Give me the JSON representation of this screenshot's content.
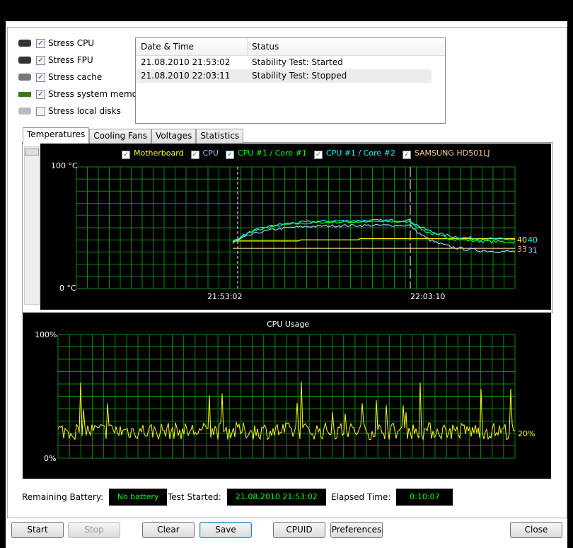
{
  "options": [
    {
      "label": "Stress CPU",
      "checked": true,
      "icon": "cpu-icon"
    },
    {
      "label": "Stress FPU",
      "checked": true,
      "icon": "fpu-icon"
    },
    {
      "label": "Stress cache",
      "checked": true,
      "icon": "cache-chip-icon"
    },
    {
      "label": "Stress system memory",
      "checked": true,
      "icon": "memory-icon"
    },
    {
      "label": "Stress local disks",
      "checked": false,
      "icon": "disk-icon"
    }
  ],
  "log": {
    "headers": [
      "Date & Time",
      "Status"
    ],
    "rows": [
      [
        "21.08.2010 21:53:02",
        "Stability Test: Started"
      ],
      [
        "21.08.2010 22:03:11",
        "Stability Test: Stopped"
      ]
    ]
  },
  "tabs": [
    "Temperatures",
    "Cooling Fans",
    "Voltages",
    "Statistics"
  ],
  "temp_chart": {
    "y_max_label": "100 °C",
    "y_min_label": "0 °C",
    "x_labels": [
      "21:53:02",
      "22:03:10"
    ],
    "legend": [
      {
        "label": "Motherboard",
        "color": "#ffff00"
      },
      {
        "label": "CPU",
        "color": "#a0c8ff"
      },
      {
        "label": "CPU #1 / Core #1",
        "color": "#00ff00"
      },
      {
        "label": "CPU #1 / Core #2",
        "color": "#00ffff"
      },
      {
        "label": "SAMSUNG HD501LJ",
        "color": "#ffcc88"
      }
    ],
    "end_values": [
      {
        "text": "40",
        "color": "#ffff00"
      },
      {
        "text": "40",
        "color": "#00ffff"
      },
      {
        "text": "33",
        "color": "#ffaa55"
      },
      {
        "text": "31",
        "color": "#a0c8ff"
      }
    ]
  },
  "cpu_chart": {
    "title": "CPU Usage",
    "y_max_label": "100%",
    "y_min_label": "0%",
    "current": "20%"
  },
  "status": {
    "battery_label": "Remaining Battery:",
    "battery": "No battery",
    "started_label": "Test Started:",
    "started": "21.08.2010 21:53:02",
    "elapsed_label": "Elapsed Time:",
    "elapsed": "0:10:07"
  },
  "buttons": {
    "start": "Start",
    "stop": "Stop",
    "clear": "Clear",
    "save": "Save",
    "cpuid": "CPUID",
    "preferences": "Preferences",
    "close": "Close"
  }
}
